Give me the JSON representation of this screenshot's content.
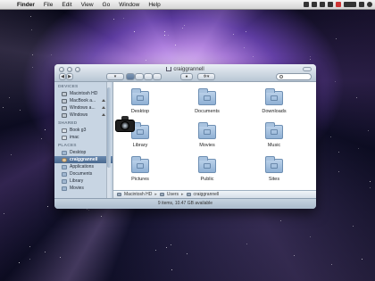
{
  "menubar": {
    "app": "Finder",
    "items": [
      "File",
      "Edit",
      "View",
      "Go",
      "Window",
      "Help"
    ]
  },
  "window": {
    "title": "craiggrannell",
    "status": "9 items, 10.47 GB available"
  },
  "sidebar": {
    "devices_header": "DEVICES",
    "devices": [
      "Macintosh HD",
      "MacBook a...",
      "Windows a...",
      "Windows"
    ],
    "shared_header": "SHARED",
    "shared": [
      "Book g3",
      "imac"
    ],
    "places_header": "PLACES",
    "places": [
      "Desktop",
      "craiggrannell",
      "Applications",
      "Documents",
      "Library",
      "Movies"
    ]
  },
  "content": {
    "items": [
      "Desktop",
      "Documents",
      "Downloads",
      "Library",
      "Movies",
      "Music",
      "Pictures",
      "Public",
      "Sites"
    ]
  },
  "pathbar": {
    "segments": [
      "Macintosh HD",
      "Users",
      "craiggrannell"
    ]
  },
  "colors": {
    "selection": "#5a7aa1",
    "folder": "#9fbcdc",
    "window_chrome": "#c9d6e3"
  }
}
